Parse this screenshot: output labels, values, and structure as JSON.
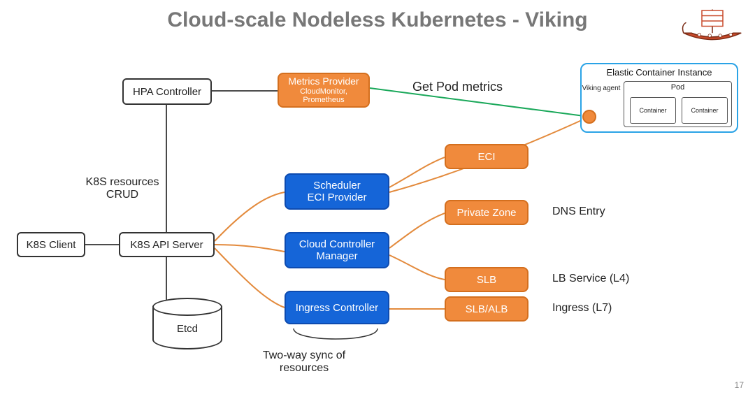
{
  "title": "Cloud-scale Nodeless Kubernetes - Viking",
  "page_number": "17",
  "labels": {
    "k8s_resources_crud": "K8S resources\nCRUD",
    "get_pod_metrics": "Get Pod metrics",
    "two_way_sync": "Two-way sync of\nresources",
    "dns_entry": "DNS Entry",
    "lb_service": "LB Service (L4)",
    "ingress_l7": "Ingress (L7)"
  },
  "boxes": {
    "k8s_client": "K8S Client",
    "k8s_api_server": "K8S API Server",
    "hpa_controller": "HPA Controller",
    "metrics_provider": "Metrics Provider",
    "metrics_provider_sub": "CloudMonitor,\nPrometheus",
    "scheduler": "Scheduler\nECI Provider",
    "ccm": "Cloud Controller\nManager",
    "ingress_controller": "Ingress Controller",
    "eci": "ECI",
    "private_zone": "Private Zone",
    "slb": "SLB",
    "slb_alb": "SLB/ALB",
    "etcd": "Etcd"
  },
  "eci_box": {
    "title": "Elastic Container Instance",
    "viking_agent": "Viking\nagent",
    "pod": "Pod",
    "container": "Container"
  },
  "colors": {
    "blue": "#1565d8",
    "orange": "#f08a3c",
    "green_line": "#1aa85a",
    "orange_line": "#e38a3c",
    "eci_border": "#2aa3e6"
  }
}
